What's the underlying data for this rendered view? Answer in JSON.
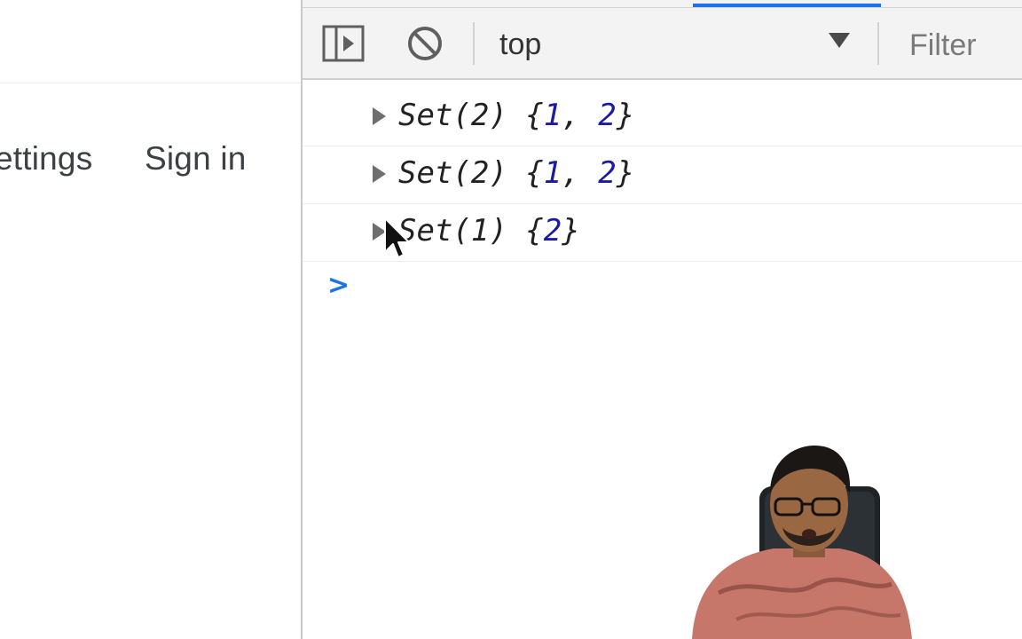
{
  "page": {
    "header_links": [
      "ettings",
      "Sign in"
    ]
  },
  "devtools": {
    "toolbar": {
      "context_value": "top",
      "filter_placeholder": "Filter"
    },
    "console_rows": [
      {
        "prefix": "Set(2) {",
        "values": [
          "1",
          "2"
        ],
        "suffix": "}"
      },
      {
        "prefix": "Set(2) {",
        "values": [
          "1",
          "2"
        ],
        "suffix": "}"
      },
      {
        "prefix": "Set(1) {",
        "values": [
          "2"
        ],
        "suffix": "}"
      }
    ],
    "prompt_symbol": ">"
  },
  "icons": {
    "sidebar_toggle": "sidebar-toggle-icon",
    "clear_console": "clear-console-icon",
    "dropdown": "dropdown-arrow-icon",
    "expand": "expand-arrow-icon",
    "cursor": "mouse-pointer-icon"
  },
  "colors": {
    "toolbar_bg": "#f3f3f3",
    "accent": "#1a73e8",
    "number": "#1a1aa6",
    "text": "#222222"
  },
  "overlay": {
    "webcam": "presenter-webcam"
  }
}
